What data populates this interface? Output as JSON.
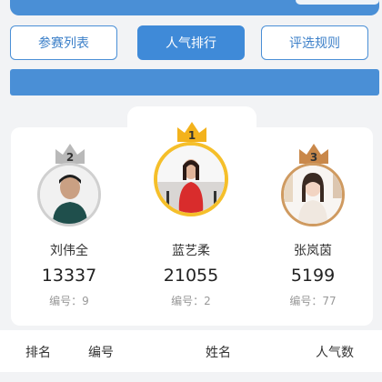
{
  "tabs": [
    {
      "label": "参赛列表",
      "active": false
    },
    {
      "label": "人气排行",
      "active": true
    },
    {
      "label": "评选规则",
      "active": false
    }
  ],
  "podium": [
    {
      "rank": "2",
      "name": "刘伟全",
      "votes": "13337",
      "number": "编号：9",
      "crown_color": "#b9b9b9",
      "ring_color": "#d0d0d0"
    },
    {
      "rank": "1",
      "name": "蓝艺柔",
      "votes": "21055",
      "number": "编号：2",
      "crown_color": "#f3b21c",
      "ring_color": "#f5bf2a"
    },
    {
      "rank": "3",
      "name": "张岚茵",
      "votes": "5199",
      "number": "编号：77",
      "crown_color": "#c9884a",
      "ring_color": "#cf9a60"
    }
  ],
  "table_header": {
    "rank": "排名",
    "number": "编号",
    "name": "姓名",
    "votes": "人气数"
  },
  "colors": {
    "accent": "#4a8fd6",
    "active_tab": "#3f8ad8",
    "background": "#f2f3f5"
  }
}
